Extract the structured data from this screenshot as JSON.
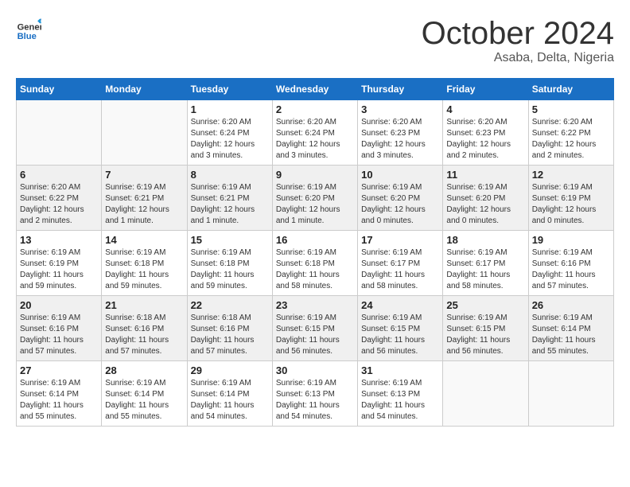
{
  "header": {
    "logo": {
      "general": "General",
      "blue": "Blue"
    },
    "title": "October 2024",
    "location": "Asaba, Delta, Nigeria"
  },
  "weekdays": [
    "Sunday",
    "Monday",
    "Tuesday",
    "Wednesday",
    "Thursday",
    "Friday",
    "Saturday"
  ],
  "weeks": [
    [
      {
        "day": "",
        "info": ""
      },
      {
        "day": "",
        "info": ""
      },
      {
        "day": "1",
        "info": "Sunrise: 6:20 AM\nSunset: 6:24 PM\nDaylight: 12 hours and 3 minutes."
      },
      {
        "day": "2",
        "info": "Sunrise: 6:20 AM\nSunset: 6:24 PM\nDaylight: 12 hours and 3 minutes."
      },
      {
        "day": "3",
        "info": "Sunrise: 6:20 AM\nSunset: 6:23 PM\nDaylight: 12 hours and 3 minutes."
      },
      {
        "day": "4",
        "info": "Sunrise: 6:20 AM\nSunset: 6:23 PM\nDaylight: 12 hours and 2 minutes."
      },
      {
        "day": "5",
        "info": "Sunrise: 6:20 AM\nSunset: 6:22 PM\nDaylight: 12 hours and 2 minutes."
      }
    ],
    [
      {
        "day": "6",
        "info": "Sunrise: 6:20 AM\nSunset: 6:22 PM\nDaylight: 12 hours and 2 minutes."
      },
      {
        "day": "7",
        "info": "Sunrise: 6:19 AM\nSunset: 6:21 PM\nDaylight: 12 hours and 1 minute."
      },
      {
        "day": "8",
        "info": "Sunrise: 6:19 AM\nSunset: 6:21 PM\nDaylight: 12 hours and 1 minute."
      },
      {
        "day": "9",
        "info": "Sunrise: 6:19 AM\nSunset: 6:20 PM\nDaylight: 12 hours and 1 minute."
      },
      {
        "day": "10",
        "info": "Sunrise: 6:19 AM\nSunset: 6:20 PM\nDaylight: 12 hours and 0 minutes."
      },
      {
        "day": "11",
        "info": "Sunrise: 6:19 AM\nSunset: 6:20 PM\nDaylight: 12 hours and 0 minutes."
      },
      {
        "day": "12",
        "info": "Sunrise: 6:19 AM\nSunset: 6:19 PM\nDaylight: 12 hours and 0 minutes."
      }
    ],
    [
      {
        "day": "13",
        "info": "Sunrise: 6:19 AM\nSunset: 6:19 PM\nDaylight: 11 hours and 59 minutes."
      },
      {
        "day": "14",
        "info": "Sunrise: 6:19 AM\nSunset: 6:18 PM\nDaylight: 11 hours and 59 minutes."
      },
      {
        "day": "15",
        "info": "Sunrise: 6:19 AM\nSunset: 6:18 PM\nDaylight: 11 hours and 59 minutes."
      },
      {
        "day": "16",
        "info": "Sunrise: 6:19 AM\nSunset: 6:18 PM\nDaylight: 11 hours and 58 minutes."
      },
      {
        "day": "17",
        "info": "Sunrise: 6:19 AM\nSunset: 6:17 PM\nDaylight: 11 hours and 58 minutes."
      },
      {
        "day": "18",
        "info": "Sunrise: 6:19 AM\nSunset: 6:17 PM\nDaylight: 11 hours and 58 minutes."
      },
      {
        "day": "19",
        "info": "Sunrise: 6:19 AM\nSunset: 6:16 PM\nDaylight: 11 hours and 57 minutes."
      }
    ],
    [
      {
        "day": "20",
        "info": "Sunrise: 6:19 AM\nSunset: 6:16 PM\nDaylight: 11 hours and 57 minutes."
      },
      {
        "day": "21",
        "info": "Sunrise: 6:18 AM\nSunset: 6:16 PM\nDaylight: 11 hours and 57 minutes."
      },
      {
        "day": "22",
        "info": "Sunrise: 6:18 AM\nSunset: 6:16 PM\nDaylight: 11 hours and 57 minutes."
      },
      {
        "day": "23",
        "info": "Sunrise: 6:19 AM\nSunset: 6:15 PM\nDaylight: 11 hours and 56 minutes."
      },
      {
        "day": "24",
        "info": "Sunrise: 6:19 AM\nSunset: 6:15 PM\nDaylight: 11 hours and 56 minutes."
      },
      {
        "day": "25",
        "info": "Sunrise: 6:19 AM\nSunset: 6:15 PM\nDaylight: 11 hours and 56 minutes."
      },
      {
        "day": "26",
        "info": "Sunrise: 6:19 AM\nSunset: 6:14 PM\nDaylight: 11 hours and 55 minutes."
      }
    ],
    [
      {
        "day": "27",
        "info": "Sunrise: 6:19 AM\nSunset: 6:14 PM\nDaylight: 11 hours and 55 minutes."
      },
      {
        "day": "28",
        "info": "Sunrise: 6:19 AM\nSunset: 6:14 PM\nDaylight: 11 hours and 55 minutes."
      },
      {
        "day": "29",
        "info": "Sunrise: 6:19 AM\nSunset: 6:14 PM\nDaylight: 11 hours and 54 minutes."
      },
      {
        "day": "30",
        "info": "Sunrise: 6:19 AM\nSunset: 6:13 PM\nDaylight: 11 hours and 54 minutes."
      },
      {
        "day": "31",
        "info": "Sunrise: 6:19 AM\nSunset: 6:13 PM\nDaylight: 11 hours and 54 minutes."
      },
      {
        "day": "",
        "info": ""
      },
      {
        "day": "",
        "info": ""
      }
    ]
  ],
  "shaded_rows": [
    1,
    3
  ]
}
